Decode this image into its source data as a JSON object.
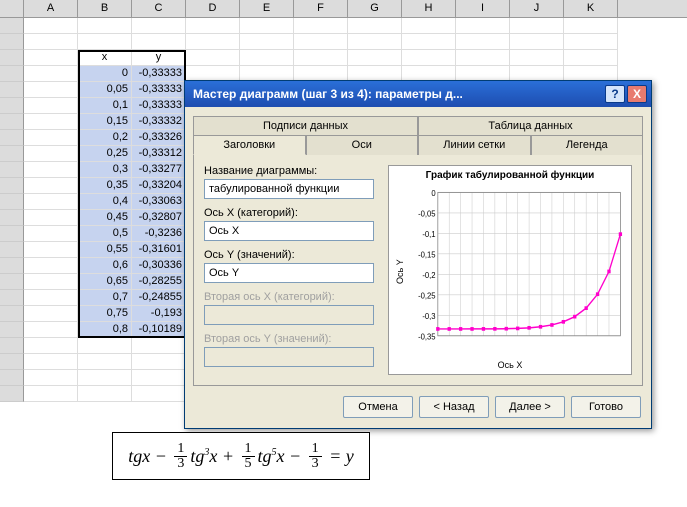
{
  "columns": [
    "A",
    "B",
    "C",
    "D",
    "E",
    "F",
    "G",
    "H",
    "I",
    "J",
    "K"
  ],
  "table": {
    "header_x": "x",
    "header_y": "y",
    "rows": [
      {
        "x": "0",
        "y": "-0,33333"
      },
      {
        "x": "0,05",
        "y": "-0,33333"
      },
      {
        "x": "0,1",
        "y": "-0,33333"
      },
      {
        "x": "0,15",
        "y": "-0,33332"
      },
      {
        "x": "0,2",
        "y": "-0,33326"
      },
      {
        "x": "0,25",
        "y": "-0,33312"
      },
      {
        "x": "0,3",
        "y": "-0,33277"
      },
      {
        "x": "0,35",
        "y": "-0,33204"
      },
      {
        "x": "0,4",
        "y": "-0,33063"
      },
      {
        "x": "0,45",
        "y": "-0,32807"
      },
      {
        "x": "0,5",
        "y": "-0,3236"
      },
      {
        "x": "0,55",
        "y": "-0,31601"
      },
      {
        "x": "0,6",
        "y": "-0,30336"
      },
      {
        "x": "0,65",
        "y": "-0,28255"
      },
      {
        "x": "0,7",
        "y": "-0,24855"
      },
      {
        "x": "0,75",
        "y": "-0,193"
      },
      {
        "x": "0,8",
        "y": "-0,10189"
      }
    ]
  },
  "dialog": {
    "title": "Мастер диаграмм (шаг 3 из 4): параметры д...",
    "help": "?",
    "close": "X",
    "tabs_top": [
      "Подписи данных",
      "Таблица данных"
    ],
    "tabs_bot": [
      "Заголовки",
      "Оси",
      "Линии сетки",
      "Легенда"
    ],
    "labels": {
      "chart_name": "Название диаграммы:",
      "chart_name_val": "табулированной функции",
      "x_cat": "Ось X (категорий):",
      "x_cat_val": "Ось X",
      "y_val": "Ось Y (значений):",
      "y_val_val": "Ось Y",
      "x2": "Вторая ось X (категорий):",
      "y2": "Вторая ось Y (значений):"
    },
    "preview": {
      "title": "График табулированной функции",
      "ylabel": "Ось Y",
      "xlabel": "Ось X"
    },
    "buttons": {
      "cancel": "Отмена",
      "back": "< Назад",
      "next": "Далее >",
      "finish": "Готово"
    }
  },
  "chart_data": {
    "type": "line",
    "title": "График табулированной функции",
    "xlabel": "Ось X",
    "ylabel": "Ось Y",
    "ylim": [
      -0.35,
      0
    ],
    "yticks": [
      0,
      -0.05,
      -0.1,
      -0.15,
      -0.2,
      -0.25,
      -0.3,
      -0.35
    ],
    "x": [
      0,
      0.05,
      0.1,
      0.15,
      0.2,
      0.25,
      0.3,
      0.35,
      0.4,
      0.45,
      0.5,
      0.55,
      0.6,
      0.65,
      0.7,
      0.75,
      0.8
    ],
    "values": [
      -0.33333,
      -0.33333,
      -0.33333,
      -0.33332,
      -0.33326,
      -0.33312,
      -0.33277,
      -0.33204,
      -0.33063,
      -0.32807,
      -0.3236,
      -0.31601,
      -0.30336,
      -0.28255,
      -0.24855,
      -0.193,
      -0.10189
    ]
  },
  "formula": {
    "text": "tgx − 1/3 tg³x + 1/5 tg⁵x − 1/3 = y"
  }
}
